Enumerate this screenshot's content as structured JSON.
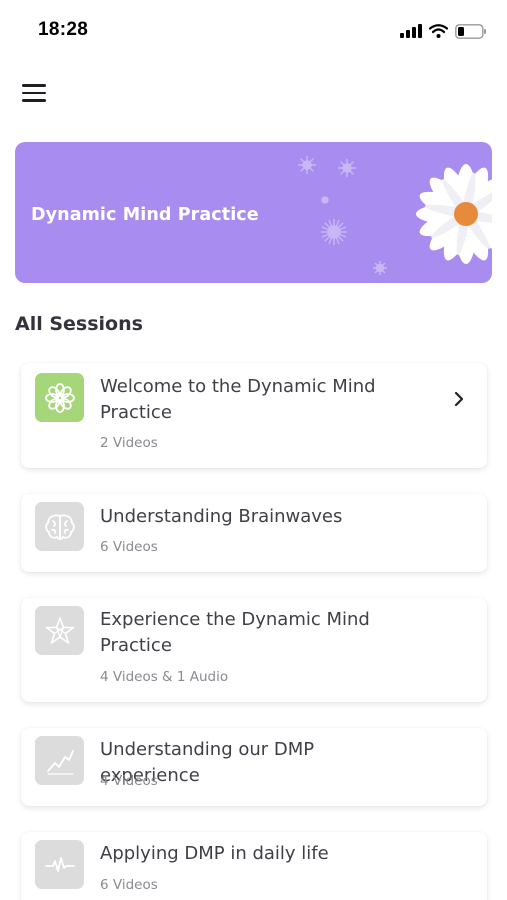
{
  "status_bar": {
    "time": "18:28",
    "icons": [
      "signal-icon",
      "wifi-icon",
      "battery-icon"
    ]
  },
  "header": {
    "menu_icon": "hamburger-menu-icon"
  },
  "banner": {
    "title": "Dynamic Mind Practice",
    "background_color": "#a98cef",
    "flower_center_color": "#e68a3c"
  },
  "sections": {
    "all_sessions_title": "All Sessions"
  },
  "sessions": [
    {
      "title": "Welcome to the Dynamic Mind Practice",
      "meta": "2 Videos",
      "icon": "lotus-icon",
      "active": true
    },
    {
      "title": "Understanding Brainwaves",
      "meta": "6 Videos",
      "icon": "brain-icon",
      "active": false
    },
    {
      "title": "Experience the Dynamic Mind Practice",
      "meta": "4 Videos & 1 Audio",
      "icon": "star-icon",
      "active": false
    },
    {
      "title": "Understanding our DMP experience",
      "meta": "4 Videos",
      "icon": "chart-icon",
      "active": false
    },
    {
      "title": "Applying DMP in daily life",
      "meta": "6 Videos",
      "icon": "heartbeat-icon",
      "active": false
    }
  ],
  "colors": {
    "active_icon_bg": "#a6d67a",
    "inactive_icon_bg": "#dcdcdc"
  }
}
